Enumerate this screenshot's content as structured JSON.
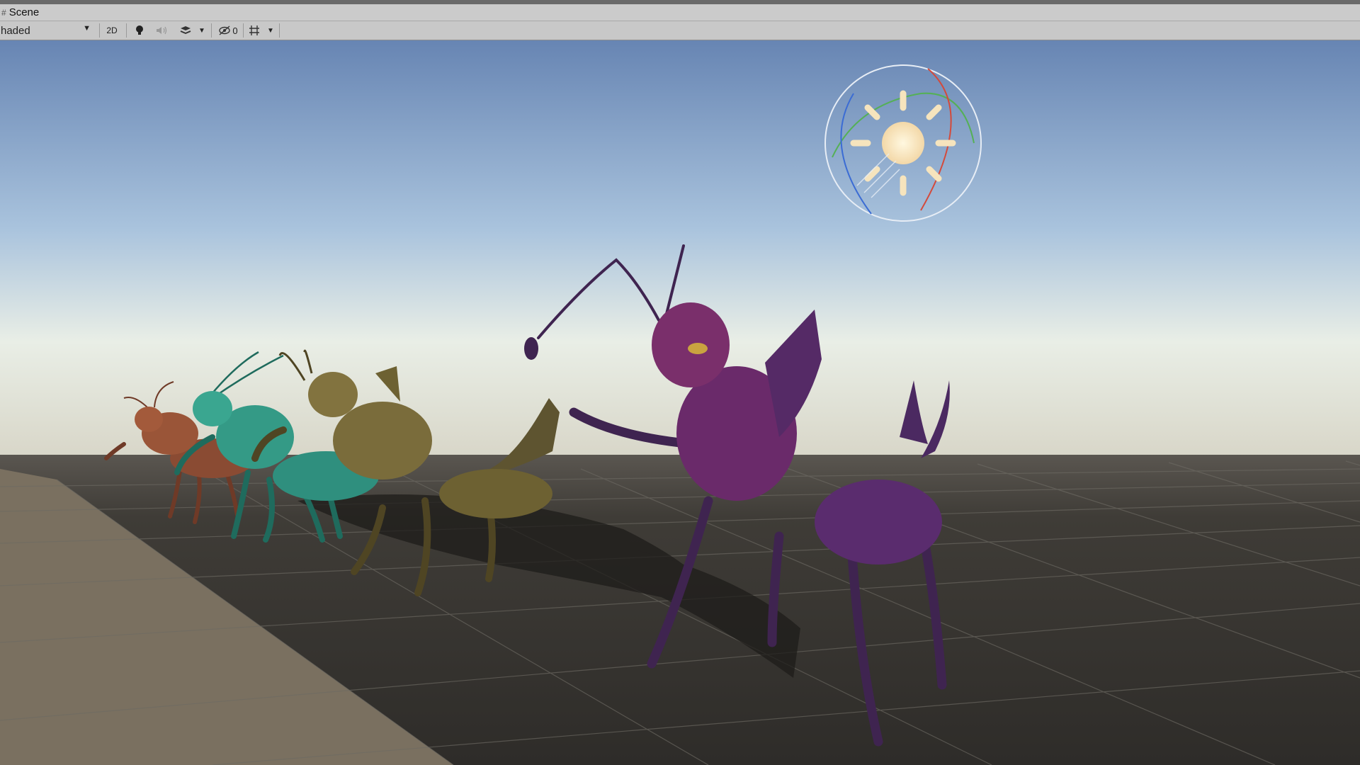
{
  "window": {
    "tab_title": "Scene",
    "tab_icon": "hash-icon"
  },
  "toolbar": {
    "shading_mode": "haded",
    "mode_2d": "2D",
    "hidden_count": "0",
    "icons": [
      "dropdown-caret-icon",
      "lightbulb-icon",
      "audio-icon",
      "effects-icon",
      "hidden-objects-icon",
      "grid-icon"
    ]
  },
  "viewport": {
    "sky_colors": [
      "#6a88b4",
      "#a8c4de",
      "#eef0e6"
    ],
    "ground_color": "#3b3935",
    "plane_color": "#7a7060",
    "creatures": [
      {
        "name": "red-ant-creature",
        "color": "#8a4b33"
      },
      {
        "name": "teal-ant-creature",
        "color": "#2f8f7e"
      },
      {
        "name": "olive-ant-creature",
        "color": "#6d6132"
      },
      {
        "name": "purple-ant-creature",
        "color": "#5a2c6e"
      }
    ],
    "gizmo": "directional-light-gizmo"
  }
}
